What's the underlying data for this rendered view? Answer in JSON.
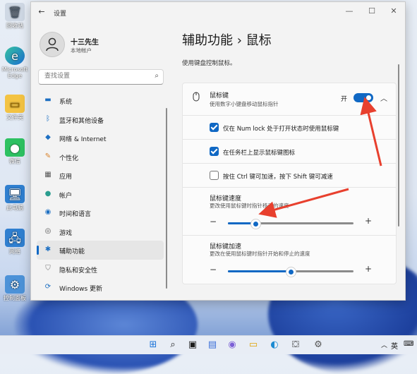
{
  "desktop": {
    "icons": [
      {
        "label": "回收站",
        "icon": "recycle-bin-icon"
      },
      {
        "label": "Microsoft Edge",
        "icon": "edge-icon"
      },
      {
        "label": "文件夹",
        "icon": "folder-icon"
      },
      {
        "label": "微信",
        "icon": "wechat-icon"
      },
      {
        "label": "此电脑",
        "icon": "computer-icon"
      },
      {
        "label": "网络",
        "icon": "network-icon"
      },
      {
        "label": "控制面板",
        "icon": "control-panel-icon"
      }
    ]
  },
  "window": {
    "title": "设置",
    "controls": {
      "minimize": "—",
      "maximize": "☐",
      "close": "✕"
    }
  },
  "profile": {
    "name": "十三先生",
    "subtitle": "本地帐户"
  },
  "search": {
    "placeholder": "查找设置"
  },
  "nav": {
    "items": [
      {
        "label": "系统",
        "icon": "system-icon"
      },
      {
        "label": "蓝牙和其他设备",
        "icon": "bluetooth-icon"
      },
      {
        "label": "网络 & Internet",
        "icon": "wifi-icon"
      },
      {
        "label": "个性化",
        "icon": "brush-icon"
      },
      {
        "label": "应用",
        "icon": "apps-icon"
      },
      {
        "label": "帐户",
        "icon": "account-icon"
      },
      {
        "label": "时间和语言",
        "icon": "globe-clock-icon"
      },
      {
        "label": "游戏",
        "icon": "gamepad-icon"
      },
      {
        "label": "辅助功能",
        "icon": "accessibility-icon",
        "active": true
      },
      {
        "label": "隐私和安全性",
        "icon": "shield-icon"
      },
      {
        "label": "Windows 更新",
        "icon": "windows-update-icon"
      }
    ]
  },
  "page": {
    "title": "辅助功能  ›  鼠标",
    "subtitle": "使用键盘控制鼠标。"
  },
  "mouse_keys": {
    "title": "鼠标键",
    "description": "使用数字小键盘移动鼠标指针",
    "toggle_label": "开",
    "toggle_on": true
  },
  "options": [
    {
      "label": "仅在 Num lock 处于打开状态时使用鼠标键",
      "checked": true
    },
    {
      "label": "在任务栏上显示鼠标键图标",
      "checked": true
    },
    {
      "label": "按住 Ctrl 键可加速，按下 Shift 键可减速",
      "checked": false
    }
  ],
  "speed": {
    "title": "鼠标键速度",
    "description": "更改使用鼠标键时指针移动的速度",
    "minus": "−",
    "plus": "+",
    "value": 0.22
  },
  "acceleration": {
    "title": "鼠标键加速",
    "description": "更改在使用鼠标键时指针开始和停止的速度",
    "minus": "−",
    "plus": "+",
    "value": 0.5
  },
  "taskbar": {
    "tray_chevron": "︿",
    "ime": "英",
    "network": "⌨"
  },
  "colors": {
    "accent": "#1068c4",
    "annotation": "#e8402e"
  }
}
